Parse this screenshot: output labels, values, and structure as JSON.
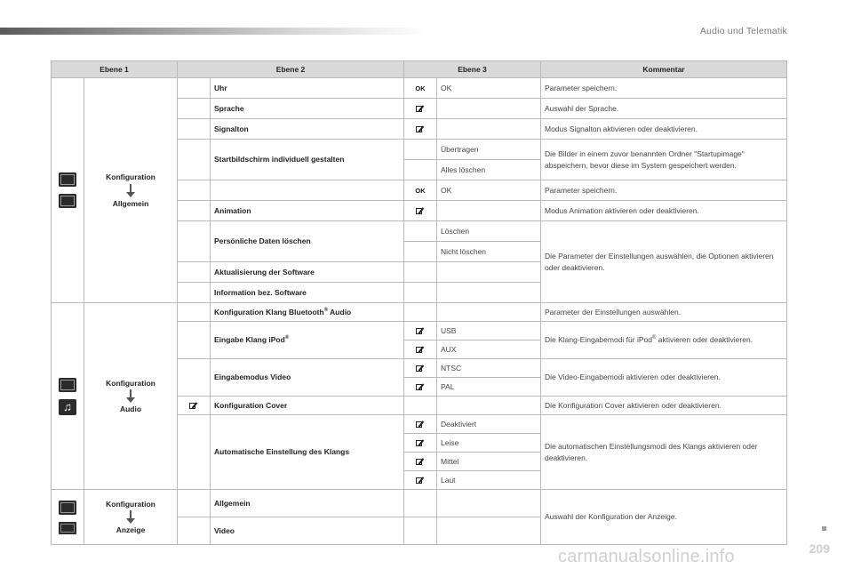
{
  "header": {
    "section_title": "Audio und Telematik"
  },
  "footer": {
    "page_number": "209",
    "watermark": "carmanualsonline.info"
  },
  "table": {
    "columns": [
      "Ebene 1",
      "Ebene 2",
      "Ebene 3",
      "Kommentar"
    ],
    "groups": [
      {
        "level1": {
          "line1": "Konfiguration",
          "line2": "Allgemein",
          "icons": [
            "gear-icon",
            "gear-icon"
          ]
        },
        "rows": [
          {
            "level2": "Uhr",
            "level2_icon": "",
            "l3_icon": "ok-icon",
            "level3": "OK",
            "comment": "Parameter speichern."
          },
          {
            "level2": "Sprache",
            "l3_icon": "edit-icon",
            "level3": "",
            "comment": "Auswahl der Sprache."
          },
          {
            "level2": "Signalton",
            "l3_icon": "edit-icon",
            "level3": "",
            "comment": "Modus Signalton aktivieren oder deaktivieren."
          },
          {
            "level2": "Startbildschirm individuell gestalten",
            "sub": [
              {
                "l3_icon": "",
                "level3": "Übertragen"
              },
              {
                "l3_icon": "",
                "level3": "Alles löschen"
              }
            ],
            "comment": "Die Bilder in einem zuvor benannten Ordner \"Startupimage\" abspeichern, bevor diese im System gespeichert werden."
          },
          {
            "l3_icon": "ok-icon",
            "level3": "OK",
            "comment": "Parameter speichern."
          },
          {
            "level2": "Animation",
            "l3_icon": "edit-icon",
            "level3": "",
            "comment": "Modus Animation aktivieren oder deaktivieren."
          },
          {
            "level2": "Persönliche Daten löschen",
            "sub": [
              {
                "level3": "Löschen"
              },
              {
                "level3": "Nicht löschen"
              }
            ],
            "comment": "Die Parameter der Einstellungen auswählen, die Optionen aktivieren oder deaktivieren."
          },
          {
            "level2": "Aktualisierung der Software"
          },
          {
            "level2": "Information bez. Software"
          }
        ]
      },
      {
        "level1": {
          "line1": "Konfiguration",
          "line2": "Audio",
          "icons": [
            "gear-icon",
            "music-note-icon"
          ]
        },
        "rows": [
          {
            "level2": "Konfiguration Klang Bluetooth",
            "level2_sup": "®",
            "level2_suffix": " Audio",
            "comment": "Parameter der Einstellungen auswählen."
          },
          {
            "level2": "Eingabe Klang iPod",
            "level2_sup": "®",
            "sub": [
              {
                "l3_icon": "edit-icon",
                "level3": "USB"
              },
              {
                "l3_icon": "edit-icon",
                "level3": "AUX"
              }
            ],
            "comment_pre": "Die Klang-Eingabemodi für iPod",
            "comment_sup": "®",
            "comment_post": " aktivieren oder deaktivieren."
          },
          {
            "level2": "Eingabemodus Video",
            "sub": [
              {
                "l3_icon": "edit-icon",
                "level3": "NTSC"
              },
              {
                "l3_icon": "edit-icon",
                "level3": "PAL"
              }
            ],
            "comment": "Die Video-Eingabemodi aktivieren oder deaktivieren."
          },
          {
            "level2": "Konfiguration Cover",
            "level2_icon": "edit-icon",
            "comment": "Die Konfiguration Cover aktivieren oder deaktivieren."
          },
          {
            "level2": "Automatische Einstellung des Klangs",
            "sub": [
              {
                "l3_icon": "edit-icon",
                "level3": "Deaktiviert"
              },
              {
                "l3_icon": "edit-icon",
                "level3": "Leise"
              },
              {
                "l3_icon": "edit-icon",
                "level3": "Mittel"
              },
              {
                "l3_icon": "edit-icon",
                "level3": "Laut"
              }
            ],
            "comment": "Die automatischen Einstellungsmodi des Klangs aktivieren oder deaktivieren."
          }
        ]
      },
      {
        "level1": {
          "line1": "Konfiguration",
          "line2": "Anzeige",
          "icons": [
            "gear-icon",
            "display-icon"
          ]
        },
        "rows": [
          {
            "level2": "Allgemein"
          },
          {
            "level2": "Video"
          }
        ],
        "comment": "Auswahl der Konfiguration der Anzeige."
      }
    ]
  }
}
